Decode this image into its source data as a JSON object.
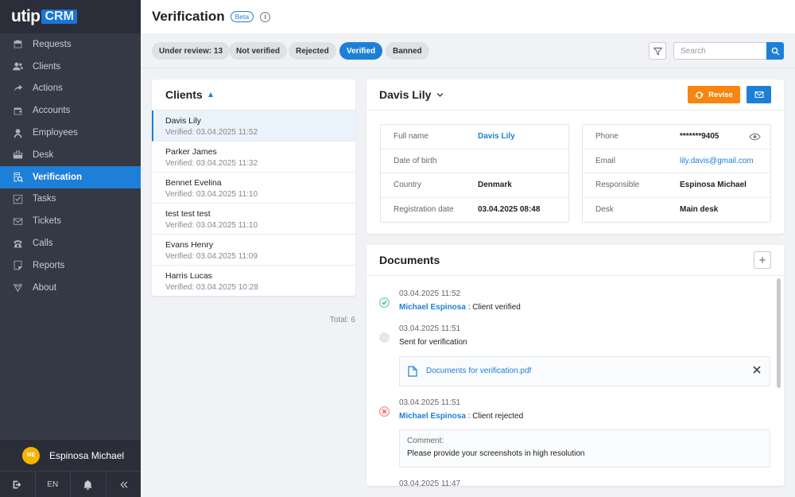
{
  "brand": {
    "name_a": "utip",
    "name_b": "CRM"
  },
  "nav": {
    "items": [
      {
        "label": "Requests",
        "icon": "briefcase-icon"
      },
      {
        "label": "Clients",
        "icon": "users-icon"
      },
      {
        "label": "Actions",
        "icon": "share-arrow-icon"
      },
      {
        "label": "Accounts",
        "icon": "wallet-icon"
      },
      {
        "label": "Employees",
        "icon": "person-icon"
      },
      {
        "label": "Desk",
        "icon": "desk-icon"
      },
      {
        "label": "Verification",
        "icon": "verification-icon"
      },
      {
        "label": "Tasks",
        "icon": "checkbox-icon"
      },
      {
        "label": "Tickets",
        "icon": "envelope-icon"
      },
      {
        "label": "Calls",
        "icon": "phone-icon"
      },
      {
        "label": "Reports",
        "icon": "report-icon"
      },
      {
        "label": "About",
        "icon": "about-icon"
      }
    ],
    "active": "Verification"
  },
  "user": {
    "initials": "ME",
    "name": "Espinosa Michael"
  },
  "bottom": {
    "lang": "EN"
  },
  "header": {
    "title": "Verification",
    "badge": "Beta"
  },
  "filters": {
    "chips": [
      {
        "label": "Under review: 13",
        "active": false
      },
      {
        "label": "Not verified",
        "active": false
      },
      {
        "label": "Rejected",
        "active": false
      },
      {
        "label": "Verified",
        "active": true
      },
      {
        "label": "Banned",
        "active": false
      }
    ],
    "search_placeholder": "Search"
  },
  "clients": {
    "title": "Clients",
    "rows": [
      {
        "name": "Davis Lily",
        "status": "Verified: 03.04.2025 11:52"
      },
      {
        "name": "Parker James",
        "status": "Verified: 03.04.2025 11:32"
      },
      {
        "name": "Bennet Evelina",
        "status": "Verified: 03.04.2025 11:10"
      },
      {
        "name": "test test test",
        "status": "Verified: 03.04.2025 11:10"
      },
      {
        "name": "Evans Henry",
        "status": "Verified: 03.04.2025 11:09"
      },
      {
        "name": "Harris Lucas",
        "status": "Verified: 03.04.2025 10:28"
      }
    ],
    "total": "Total: 6"
  },
  "detail": {
    "name": "Davis Lily",
    "revise_label": "Revise",
    "left": [
      {
        "label": "Full name",
        "value": "Davis Lily"
      },
      {
        "label": "Date of birth",
        "value": ""
      },
      {
        "label": "Country",
        "value": "Denmark"
      },
      {
        "label": "Registration date",
        "value": "03.04.2025 08:48"
      }
    ],
    "right": [
      {
        "label": "Phone",
        "value": "*******9405"
      },
      {
        "label": "Email",
        "value": "lily.davis@gmail.com"
      },
      {
        "label": "Responsible",
        "value": "Espinosa Michael"
      },
      {
        "label": "Desk",
        "value": "Main desk"
      }
    ]
  },
  "documents": {
    "title": "Documents",
    "events": [
      {
        "date": "03.04.2025 11:52",
        "who": "Michael Espinosa",
        "text": " : Client verified"
      },
      {
        "date": "03.04.2025 11:51",
        "text": "Sent for verification",
        "file": "Documents for verification.pdf"
      },
      {
        "date": "03.04.2025 11:51",
        "who": "Michael Espinosa",
        "text": " : Client rejected",
        "comment_label": "Comment:",
        "comment": "Please provide your screenshots in high resolution"
      },
      {
        "date": "03.04.2025 11:47"
      }
    ]
  },
  "colors": {
    "accent": "#1e7fd8",
    "sidebar": "#353845",
    "revise": "#f7850f",
    "avatar": "#f5b400"
  }
}
